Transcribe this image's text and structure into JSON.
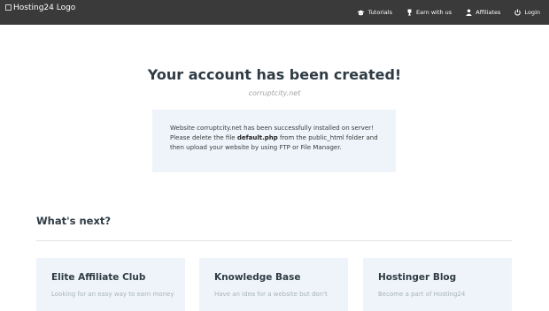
{
  "header": {
    "logo_alt": "Hosting24 Logo",
    "nav": [
      {
        "label": "Tutorials",
        "icon": "graduation-cap-icon"
      },
      {
        "label": "Earn with us",
        "icon": "trophy-icon"
      },
      {
        "label": "Affiliates",
        "icon": "user-icon"
      },
      {
        "label": "Login",
        "icon": "power-icon"
      }
    ]
  },
  "hero": {
    "title": "Your account has been created!",
    "domain": "corruptcity.net"
  },
  "notice": {
    "line1": "Website corruptcity.net has been successfully installed on server!",
    "line2_pre": "Please delete the file ",
    "line2_file": "default.php",
    "line2_post": " from the public_html folder and",
    "line3": "then upload your website by using FTP or File Manager."
  },
  "next": {
    "title": "What's next?",
    "cards": [
      {
        "title": "Elite Affiliate Club",
        "text": "Looking for an easy way to earn money"
      },
      {
        "title": "Knowledge Base",
        "text": "Have an idea for a website but don't"
      },
      {
        "title": "Hostinger Blog",
        "text": "Become a part of Hosting24"
      }
    ]
  },
  "colors": {
    "topbar": "#3a3a3a",
    "panel": "#eef4fa",
    "heading": "#2f3b44"
  }
}
